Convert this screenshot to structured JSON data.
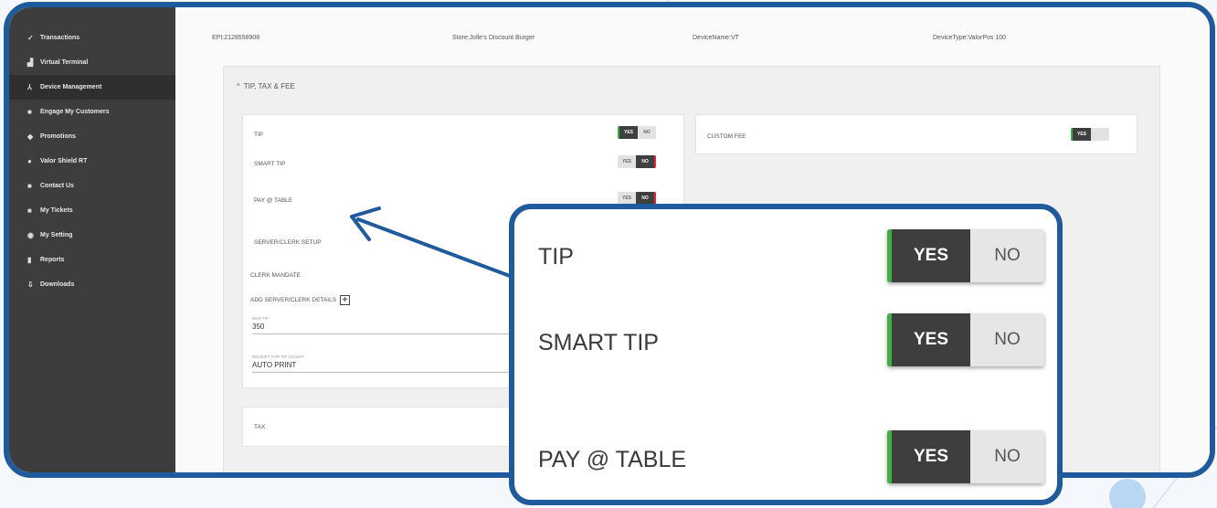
{
  "sidebar": {
    "items": [
      {
        "label": "Transactions",
        "icon": "check-icon"
      },
      {
        "label": "Virtual Terminal",
        "icon": "terminal-icon"
      },
      {
        "label": "Device Management",
        "icon": "person-icon"
      },
      {
        "label": "Engage My Customers",
        "icon": "square-icon"
      },
      {
        "label": "Promotions",
        "icon": "tag-icon"
      },
      {
        "label": "Valor Shield RT",
        "icon": "shield-icon"
      },
      {
        "label": "Contact Us",
        "icon": "square-icon"
      },
      {
        "label": "My Tickets",
        "icon": "square-icon"
      },
      {
        "label": "My Setting",
        "icon": "gear-icon"
      },
      {
        "label": "Reports",
        "icon": "document-icon"
      },
      {
        "label": "Downloads",
        "icon": "download-icon"
      }
    ]
  },
  "info": {
    "epi": "EPI:2128558908",
    "store": "Store:Jolle's Discount Burger",
    "device_name": "DeviceName:VT",
    "device_type": "DeviceType:ValorPos 100"
  },
  "section": {
    "title": "TIP, TAX & FEE",
    "collapse_glyph": "^"
  },
  "tip_card": {
    "tip_label": "TIP",
    "smart_tip_label": "SMART TIP",
    "pay_table_label": "PAY @ TABLE",
    "server_setup_label": "SERVER/CLERK SETUP",
    "clerk_mandate_label": "CLERK MANDATE",
    "add_server_label": "ADD SERVER/CLERK DETAILS",
    "max_tip_label": "MAX TIP",
    "max_tip_value": "350",
    "receipt_label": "RECEIPT FOR TIP ADJUST",
    "receipt_value": "AUTO PRINT",
    "yes": "YES",
    "no": "NO"
  },
  "tax_card": {
    "label": "TAX"
  },
  "fee_card": {
    "label": "CUSTOM FEE",
    "yes": "YES"
  },
  "zoom": {
    "tip_label": "TIP",
    "smart_tip_label": "SMART TIP",
    "pay_table_label": "PAY @ TABLE",
    "yes": "YES",
    "no": "NO"
  },
  "colors": {
    "frame": "#1e5a9c",
    "sidebar": "#3d3d3d",
    "yes_accent": "#3cb043",
    "no_accent": "#e2293a"
  }
}
